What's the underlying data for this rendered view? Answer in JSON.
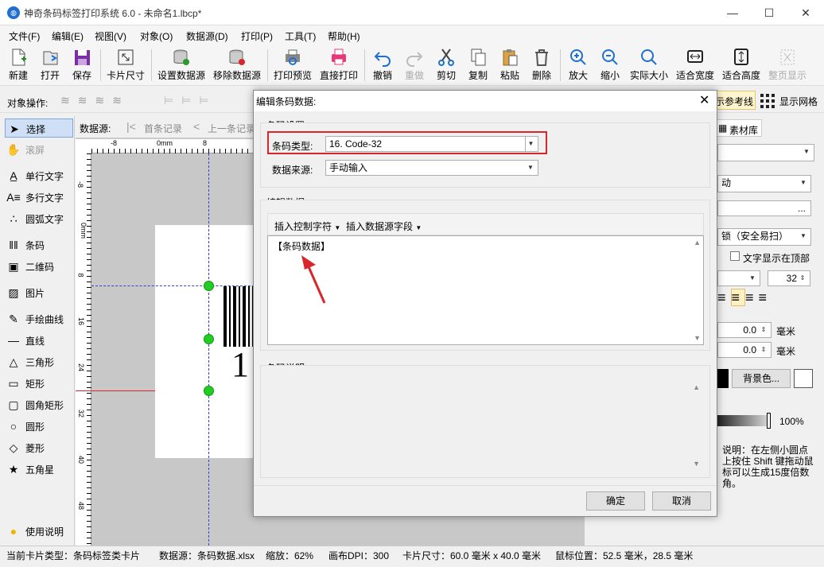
{
  "window": {
    "title": "神奇条码标签打印系统 6.0 - 未命名1.lbcp*",
    "minimize": "—",
    "maximize": "☐",
    "close": "✕"
  },
  "menu": [
    "文件(F)",
    "编辑(E)",
    "视图(V)",
    "对象(O)",
    "数据源(D)",
    "打印(P)",
    "工具(T)",
    "帮助(H)"
  ],
  "toolbar": [
    {
      "label": "新建",
      "icon": "new-file-icon"
    },
    {
      "label": "打开",
      "icon": "open-icon"
    },
    {
      "label": "保存",
      "icon": "save-icon"
    },
    {
      "label": "卡片尺寸",
      "icon": "card-size-icon"
    },
    {
      "label": "设置数据源",
      "icon": "database-set-icon"
    },
    {
      "label": "移除数据源",
      "icon": "database-remove-icon"
    },
    {
      "label": "打印预览",
      "icon": "print-preview-icon"
    },
    {
      "label": "直接打印",
      "icon": "printer-icon"
    },
    {
      "label": "撤销",
      "icon": "undo-icon"
    },
    {
      "label": "重做",
      "icon": "redo-icon"
    },
    {
      "label": "剪切",
      "icon": "scissors-icon"
    },
    {
      "label": "复制",
      "icon": "copy-icon"
    },
    {
      "label": "粘贴",
      "icon": "paste-icon"
    },
    {
      "label": "删除",
      "icon": "trash-icon"
    },
    {
      "label": "放大",
      "icon": "zoom-in-icon"
    },
    {
      "label": "缩小",
      "icon": "zoom-out-icon"
    },
    {
      "label": "实际大小",
      "icon": "zoom-actual-icon"
    },
    {
      "label": "适合宽度",
      "icon": "fit-width-icon"
    },
    {
      "label": "适合高度",
      "icon": "fit-height-icon"
    },
    {
      "label": "整页显示",
      "icon": "fit-page-icon"
    }
  ],
  "objbar": {
    "label": "对象操作:",
    "ref_lines": "示参考线",
    "grid": "显示网格"
  },
  "tools": [
    "选择",
    "滚屏",
    "单行文字",
    "多行文字",
    "圆弧文字",
    "条码",
    "二维码",
    "图片",
    "手绘曲线",
    "直线",
    "三角形",
    "矩形",
    "圆角矩形",
    "圆形",
    "菱形",
    "五角星",
    "使用说明"
  ],
  "datasource_bar": {
    "label": "数据源:",
    "first": "首条记录",
    "prev": "上一条记录"
  },
  "ruler": {
    "h": [
      "-8",
      "0mm",
      "8"
    ],
    "v": [
      "-8",
      "0mm",
      "8",
      "16",
      "24",
      "32",
      "40",
      "48"
    ]
  },
  "canvas": {
    "barcode_digit": "1"
  },
  "rightpanel": {
    "tab": "素材库",
    "combo2": "动",
    "ellipsis": "...",
    "font": "锁（安全易扫）",
    "text_top": "文字显示在顶部",
    "font_size": "32",
    "val1": "0.0",
    "unit1": "毫米",
    "val2": "0.0",
    "unit2": "毫米",
    "bg_button": "背景色...",
    "opacity": "100%",
    "hint": "说明：在左侧小圆点上按住 Shift 键拖动鼠标可以生成15度倍数角。"
  },
  "status": {
    "card_type": "当前卡片类型：条码标签类卡片",
    "datasource": "数据源：条码数据.xlsx",
    "zoom": "缩放：62%",
    "dpi": "画布DPI：300",
    "card_size": "卡片尺寸：60.0 毫米 x 40.0 毫米",
    "mouse": "鼠标位置：52.5 毫米，28.5 毫米"
  },
  "dialog": {
    "title": "编辑条码数据:",
    "group_settings": "条码设置",
    "type_label": "条码类型:",
    "type_value": "16. Code-32",
    "source_label": "数据来源:",
    "source_value": "手动输入",
    "group_edit": "编辑数据",
    "insert_ctrl": "插入控制字符",
    "insert_field": "插入数据源字段",
    "data_text": "【条码数据】",
    "group_desc": "条码说明",
    "ok": "确定",
    "cancel": "取消"
  },
  "colors": {
    "highlight_red": "#d9262c",
    "handle_green": "#22cc22",
    "accent_blue": "#1f6fd1"
  }
}
